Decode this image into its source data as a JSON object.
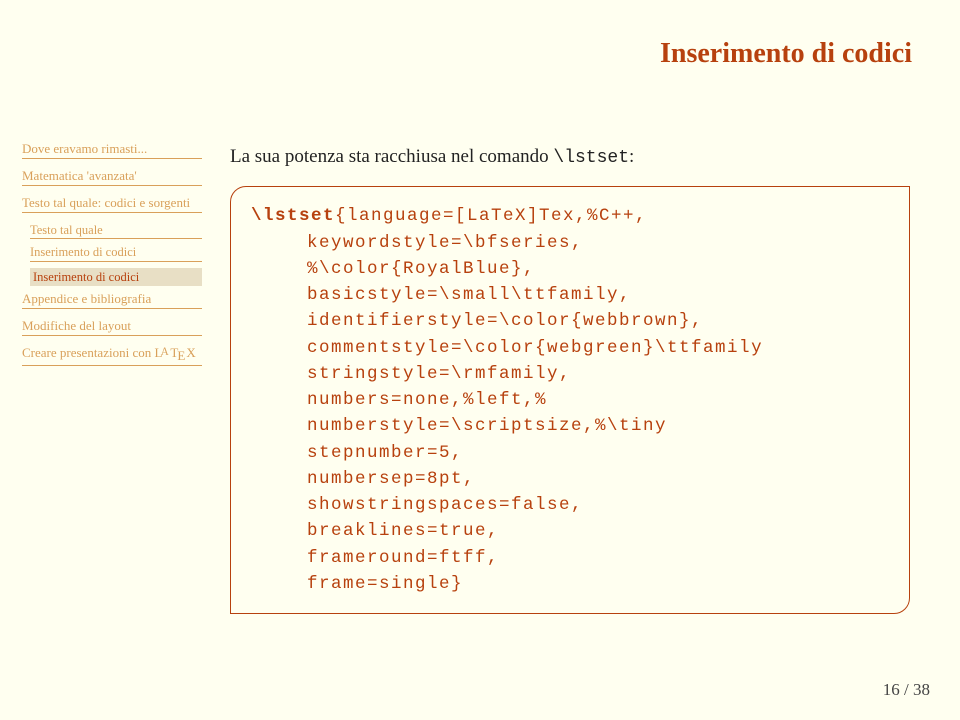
{
  "title": "Inserimento di codici",
  "nav": {
    "items": [
      "Dove eravamo rimasti...",
      "Matematica 'avanzata'",
      "Testo tal quale: codici e sorgenti",
      "Appendice e bibliografia",
      "Modifiche del layout",
      "Creare presentazioni con LᴬTᴇX"
    ],
    "sub": [
      "Testo tal quale",
      "Inserimento di codici",
      "Inserimento di codici"
    ]
  },
  "intro_pre": "La sua potenza sta racchiusa nel comando ",
  "intro_cmd": "\\lstset",
  "intro_post": ":",
  "code": {
    "l0a": "\\lstset",
    "l0b": "{language=[LaTeX]Tex,%C++,",
    "l1": "keywordstyle=\\bfseries,",
    "l2": "%\\color{RoyalBlue},",
    "l3": "basicstyle=\\small\\ttfamily,",
    "l4": "identifierstyle=\\color{webbrown},",
    "l5": "commentstyle=\\color{webgreen}\\ttfamily",
    "l6": "stringstyle=\\rmfamily,",
    "l7": "numbers=none,%left,%",
    "l8": "numberstyle=\\scriptsize,%\\tiny",
    "l9": "stepnumber=5,",
    "l10": "numbersep=8pt,",
    "l11": "showstringspaces=false,",
    "l12": "breaklines=true,",
    "l13": "frameround=ftff,",
    "l14": "frame=single}"
  },
  "pagenum": "16 / 38"
}
